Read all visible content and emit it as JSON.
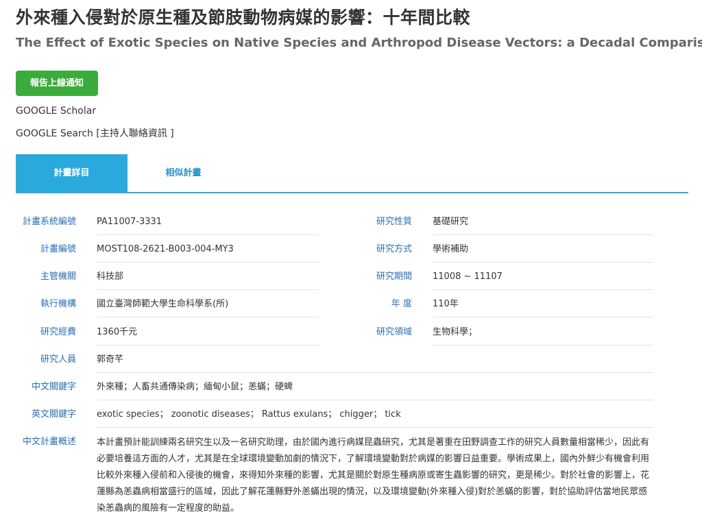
{
  "title": {
    "zh": "外來種入侵對於原生種及節肢動物病媒的影響：十年間比較",
    "en": "The Effect of Exotic Species on Native Species and Arthropod Disease Vectors: a Decadal Comparison"
  },
  "notify_button": "報告上線通知",
  "links": {
    "scholar": "GOOGLE Scholar",
    "search": "GOOGLE Search",
    "contact": "[主持人聯絡資訊 ]"
  },
  "tabs": [
    {
      "label": "計畫詳目"
    },
    {
      "label": "相似計畫"
    }
  ],
  "colors": {
    "accent": "#2aaadc",
    "label": "#2a6db5",
    "button": "#3bab3b"
  },
  "details": {
    "system_no": {
      "label": "計畫系統編號",
      "value": "PA11007-3331"
    },
    "plan_no": {
      "label": "計畫編號",
      "value": "MOST108-2621-B003-004-MY3"
    },
    "agency": {
      "label": "主管機關",
      "value": "科技部"
    },
    "executor": {
      "label": "執行機構",
      "value": "國立臺灣師範大學生命科學系(所)"
    },
    "budget": {
      "label": "研究經費",
      "value": "1360千元"
    },
    "researcher": {
      "label": "研究人員",
      "value": "郭奇芊"
    },
    "nature": {
      "label": "研究性質",
      "value": "基礎研究"
    },
    "method": {
      "label": "研究方式",
      "value": "學術補助"
    },
    "period": {
      "label": "研究期間",
      "value": "11008 ~ 11107"
    },
    "year": {
      "label": "年 度",
      "value": "110年"
    },
    "field": {
      "label": "研究領域",
      "value": "生物科學；"
    },
    "kw_zh": {
      "label": "中文關鍵字",
      "value": "外來種；人畜共通傳染病；緬甸小鼠；恙蟎；硬蜱"
    },
    "kw_en": {
      "label": "英文關鍵字",
      "value": "exotic species； zoonotic diseases； Rattus exulans； chigger； tick"
    },
    "summary_label": "中文計畫概述",
    "summary": "本計畫預計能訓練兩名研究生以及一名研究助理，由於國內進行病媒昆蟲研究，尤其是著重在田野調查工作的研究人員數量相當稀少，因此有必要培養這方面的人才，尤其是在全球環境變動加劇的情況下，了解環境變動對於病媒的影響日益重要。學術成果上，國內外鮮少有機會利用比較外來種入侵前和入侵後的機會，來得知外來種的影響，尤其是關於對原生種病原或寄生蟲影響的研究，更是稀少。對於社會的影響上，花蓮縣為恙蟲病相當盛行的區域，因此了解花蓮縣野外恙蟎出現的情況，以及環境變動(外來種入侵)對於恙蟎的影響，對於協助評估當地民眾感染恙蟲病的風險有一定程度的助益。"
  }
}
